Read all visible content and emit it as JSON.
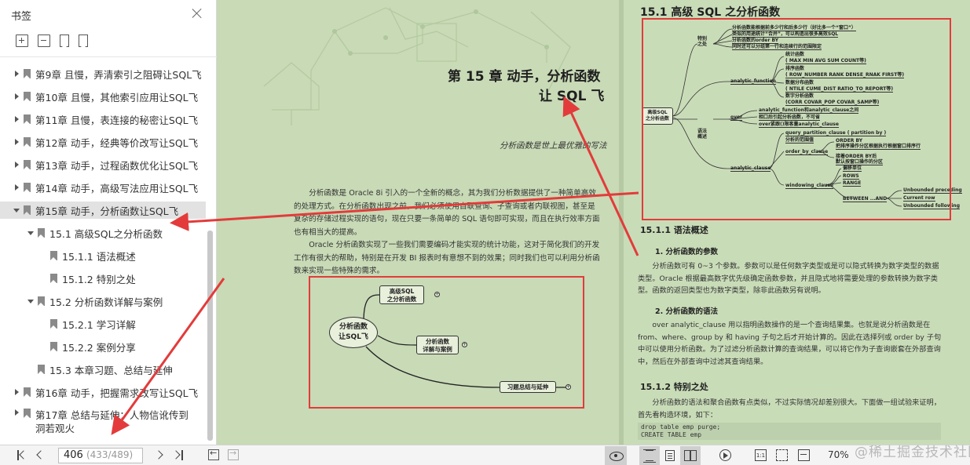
{
  "sidebar": {
    "title": "书签",
    "items": [
      {
        "label": "第9章 且慢，弄清索引之阻碍让SQL飞",
        "level": 0,
        "expander": "right"
      },
      {
        "label": "第10章 且慢，其他索引应用让SQL飞",
        "level": 0,
        "expander": "right"
      },
      {
        "label": "第11章 且慢，表连接的秘密让SQL飞",
        "level": 0,
        "expander": "right"
      },
      {
        "label": "第12章 动手，经典等价改写让SQL飞",
        "level": 0,
        "expander": "right"
      },
      {
        "label": "第13章 动手，过程函数优化让SQL飞",
        "level": 0,
        "expander": "right"
      },
      {
        "label": "第14章 动手，高级写法应用让SQL飞",
        "level": 0,
        "expander": "right"
      },
      {
        "label": "第15章 动手，分析函数让SQL飞",
        "level": 0,
        "expander": "down",
        "active": true
      },
      {
        "label": "15.1 高级SQL之分析函数",
        "level": 1,
        "expander": "down"
      },
      {
        "label": "15.1.1 语法概述",
        "level": 2,
        "expander": "none"
      },
      {
        "label": "15.1.2 特别之处",
        "level": 2,
        "expander": "none"
      },
      {
        "label": "15.2 分析函数详解与案例",
        "level": 1,
        "expander": "down"
      },
      {
        "label": "15.2.1 学习详解",
        "level": 2,
        "expander": "none"
      },
      {
        "label": "15.2.2 案例分享",
        "level": 2,
        "expander": "none"
      },
      {
        "label": "15.3 本章习题、总结与延伸",
        "level": 1,
        "expander": "none"
      },
      {
        "label": "第16章 动手，把握需求改写让SQL飞",
        "level": 0,
        "expander": "right"
      },
      {
        "label": "第17章 总结与延伸：人物信讹传到洞若观火",
        "level": 0,
        "expander": "right"
      }
    ]
  },
  "toolbar": {
    "current_page": "406",
    "page_total": "(433/489)",
    "zoom": "70%"
  },
  "watermark": "@稀土掘金技术社区",
  "left_page": {
    "chapter_title": "第 15 章   动手，分析函数",
    "chapter_subtitle": "让 SQL 飞",
    "quote": "分析函数是世上最优雅的写法",
    "para1": "分析函数是 Oracle 8i 引入的一个全新的概念，其为我们分析数据提供了一种简单高效的处理方式。在分析函数出现之前，我们必须使用自联查询、子查询或者内联视图，甚至是复杂的存储过程实现的语句，现在只要一条简单的 SQL 语句即可实现，而且在执行效率方面也有相当大的提高。",
    "para2": "Oracle 分析函数实现了一些我们需要编码才能实现的统计功能，这对于简化我们的开发工作有很大的帮助，特别是在开发 BI 报表时有意想不到的效果；同时我们也可以利用分析函数来实现一些特殊的需求。",
    "mindmap": {
      "root": "分析函数\n让SQL飞",
      "nodes": [
        "高级SQL\n之分析函数",
        "分析函数\n详解与案例",
        "习题总结与延伸"
      ]
    }
  },
  "right_page": {
    "section_title": "15.1   高级 SQL 之分析函数",
    "mindmap": {
      "root": "高级SQL\n之分析函数",
      "special": "特别\n之处",
      "special_items": [
        "分析函数能根据前多少行和后多少行（好比多一个“窗口”）",
        "类似的用途统计“合并”，可以构造出很多高效SQL",
        "分析函数的order BY",
        "同时还可以分组第一行和连续行的范围限定"
      ],
      "grammar": "语法\n概述",
      "analytic_function": "analytic_function",
      "af_items": [
        {
          "head": "统计函数",
          "sub": "( MAX MIN AVG SUM COUNT等)"
        },
        {
          "head": "排序函数",
          "sub": "( ROW_NUMBER RANK DENSE_RNAK  FIRST等)"
        },
        {
          "head": "数据分布函数",
          "sub": "( NTILE CUME_DIST  RATIO_TO_REPORT等)"
        },
        {
          "head": "数字分析函数",
          "sub": "(CORR  COVAR_POP  COVAR_SAMP等)"
        }
      ],
      "over": "over",
      "over_items": [
        "analytic_function和analytic_clause之间",
        "相口后引起分析函数，不可省",
        "over紧跟()限客量analytic_clause"
      ],
      "analytic_clause": "analytic_clause",
      "qpc": "query_partition_clause ( partition by )",
      "qpc_sub": "分析的范围值",
      "order_by": "order_by_clause",
      "order_items": [
        "ORDER BY",
        "把排序操作分区根据执行根据窗口排序行",
        "接着ORDER BY后",
        "默认按窗口操作的分区"
      ],
      "windowing": "windowing_clause",
      "win_items": [
        "偏移单位",
        "ROWS",
        "RANGE"
      ],
      "between": "BETWEEN ...AND",
      "between_items": [
        "Unbounded preceding",
        "Current row",
        "Unbounded following"
      ]
    },
    "h2_1": "15.1.1   语法概述",
    "h3_1": "1. 分析函数的参数",
    "p_params": "分析函数可有 0~3 个参数。参数可以是任何数字类型或是可以隐式转换为数字类型的数据类型。Oracle 根据最高数字优先级确定函数参数，并且隐式地将需要处理的参数转换为数字类型。函数的返回类型也为数字类型，除非此函数另有说明。",
    "h3_2": "2. 分析函数的语法",
    "p_syntax": "over analytic_clause 用以指明函数操作的是一个查询结果集。也就是说分析函数是在 from、where、group by 和 having 子句之后才开始计算的。因此在选择列或 order by 子句中可以使用分析函数。为了过滤分析函数计算的查询结果，可以将它作为子查询嵌套在外部查询中，然后在外部查询中过滤其查询结果。",
    "h2_2": "15.1.2   特别之处",
    "p_special": "分析函数的语法和聚合函数有点类似，不过实际情况却差别很大。下面做一组试验来证明，首先看构造环境，如下：",
    "code": "drop table emp purge;\nCREATE TABLE emp"
  },
  "colors": {
    "page_background": "#c8dab6",
    "annotation_red": "#e33b3b",
    "active_item_bg": "#e2e2e2"
  },
  "icons": [
    "close-icon",
    "expand-all-icon",
    "collapse-all-icon",
    "add-bookmark-icon",
    "find-bookmark-icon",
    "bookmark-icon",
    "first-page-icon",
    "prev-page-icon",
    "next-page-icon",
    "last-page-icon",
    "back-icon",
    "forward-icon",
    "eye-protection-icon",
    "scroll-mode-icon",
    "single-page-icon",
    "double-page-icon",
    "play-icon",
    "actual-size-icon",
    "fit-page-icon",
    "fit-width-icon"
  ]
}
